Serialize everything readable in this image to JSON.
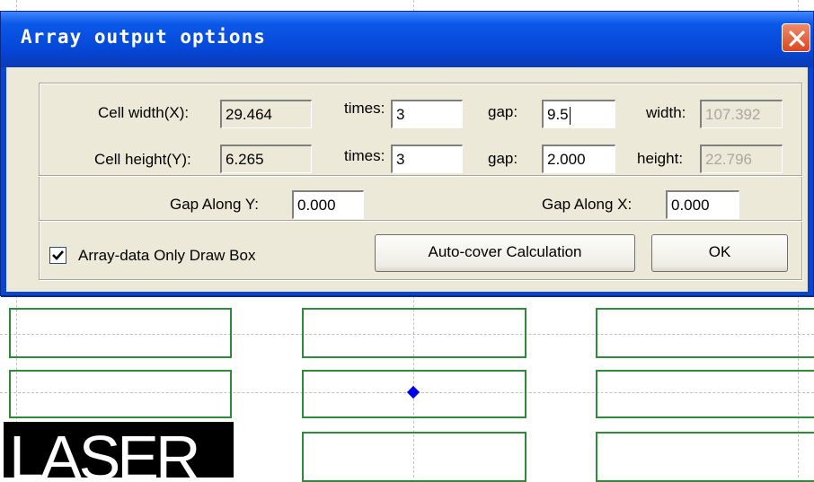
{
  "dialog": {
    "title": "Array output options",
    "close_icon": "close-icon"
  },
  "row1": {
    "cell_width_label": "Cell width(X):",
    "cell_width_value": "29.464",
    "times_label": "times:",
    "times_value": "3",
    "gap_label": "gap:",
    "gap_value": "9.5",
    "width_label": "width:",
    "width_value": "107.392"
  },
  "row2": {
    "cell_height_label": "Cell height(Y):",
    "cell_height_value": "6.265",
    "times_label": "times:",
    "times_value": "3",
    "gap_label": "gap:",
    "gap_value": "2.000",
    "height_label": "height:",
    "height_value": "22.796"
  },
  "row3": {
    "gap_along_y_label": "Gap Along Y:",
    "gap_along_y_value": "0.000",
    "gap_along_x_label": "Gap Along X:",
    "gap_along_x_value": "0.000"
  },
  "row4": {
    "checkbox_label": "Array-data Only Draw Box",
    "checkbox_checked": true,
    "auto_cover_button": "Auto-cover Calculation",
    "ok_button": "OK"
  },
  "canvas": {
    "preview_text": "LASER",
    "cell_border_color": "#2e8b3a",
    "center_marker_color": "#0000ee"
  }
}
